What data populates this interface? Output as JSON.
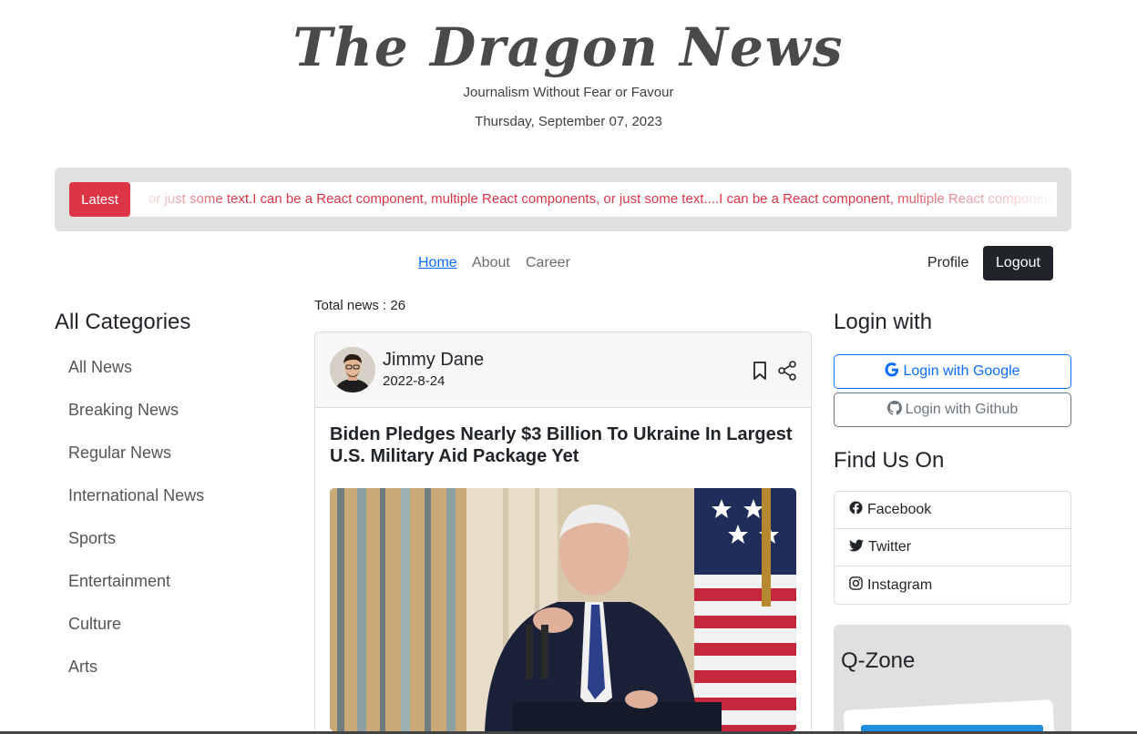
{
  "header": {
    "logo_text": "The Dragon News",
    "tagline": "Journalism Without Fear or Favour",
    "date": "Thursday, September 07, 2023"
  },
  "ticker": {
    "button_label": "Latest",
    "text": "or just some text.I can be a React component, multiple React components, or just some text....I can be a React component, multiple React components, or just some text"
  },
  "nav": {
    "links": [
      "Home",
      "About",
      "Career"
    ],
    "active": "Home",
    "profile_label": "Profile",
    "logout_label": "Logout"
  },
  "sidebar": {
    "heading": "All Categories",
    "categories": [
      "All News",
      "Breaking News",
      "Regular News",
      "International News",
      "Sports",
      "Entertainment",
      "Culture",
      "Arts"
    ]
  },
  "main": {
    "total_news_label": "Total news : 26",
    "card": {
      "author_name": "Jimmy Dane",
      "published_date": "2022-8-24",
      "title": "Biden Pledges Nearly $3 Billion To Ukraine In Largest U.S. Military Aid Package Yet",
      "icons": [
        "bookmark-icon",
        "share-icon"
      ]
    }
  },
  "right": {
    "login_heading": "Login with",
    "google_label": "Login with Google",
    "github_label": "Login with Github",
    "find_heading": "Find Us On",
    "social": [
      {
        "label": "Facebook",
        "icon": "facebook-icon"
      },
      {
        "label": "Twitter",
        "icon": "twitter-icon"
      },
      {
        "label": "Instagram",
        "icon": "instagram-icon"
      }
    ],
    "qzone_heading": "Q-Zone"
  },
  "colors": {
    "accent_red": "#dc3545",
    "link_blue": "#0d6efd",
    "dark": "#212529"
  }
}
